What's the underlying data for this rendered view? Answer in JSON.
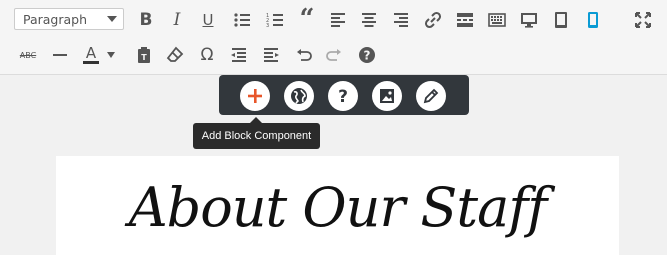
{
  "toolbar": {
    "format_select": {
      "selected": "Paragraph"
    },
    "row1": [
      "bold-icon",
      "italic-icon",
      "underline-icon",
      "bullet-list-icon",
      "numbered-list-icon",
      "blockquote-icon",
      "align-left-icon",
      "align-center-icon",
      "align-right-icon",
      "link-icon",
      "read-more-icon",
      "toolbar-toggle-icon",
      "desktop-view-icon",
      "tablet-view-icon",
      "mobile-view-icon",
      "fullscreen-icon"
    ],
    "row2": [
      "strikethrough-icon",
      "horizontal-line-icon",
      "text-color-icon",
      "paste-text-icon",
      "clear-formatting-icon",
      "special-character-icon",
      "outdent-icon",
      "indent-icon",
      "undo-icon",
      "redo-icon",
      "help-icon"
    ]
  },
  "block_popup": {
    "buttons": [
      "add-block-icon",
      "globe-icon",
      "help-icon",
      "image-icon",
      "edit-icon"
    ],
    "colors": {
      "add": "#e8562a",
      "bar": "#32373c"
    }
  },
  "tooltip": {
    "text": "Add Block Component"
  },
  "content": {
    "heading": "About Our Staff"
  }
}
